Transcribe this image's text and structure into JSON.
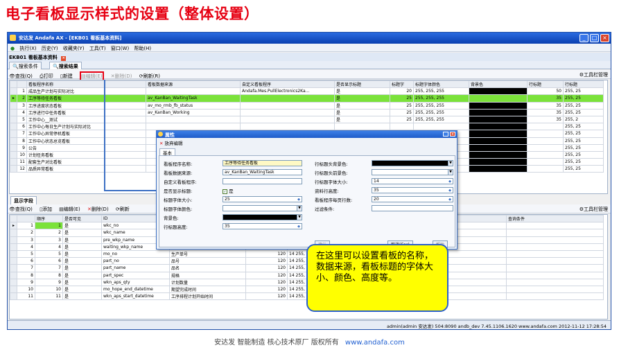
{
  "slide_title": "电子看板显示样式的设置（整体设置）",
  "window": {
    "title": "安达发 Andafa AX - [EKB01 看板基本资料]",
    "controls": [
      "_",
      "□",
      "×"
    ]
  },
  "menu": [
    "执行(X)",
    "历史(Y)",
    "收藏夹(Y)",
    "工具(T)",
    "窗口(W)",
    "帮助(H)"
  ],
  "doc_tab": "EKB01 看板基本资料",
  "tabs": [
    "搜索条件",
    "搜索结果"
  ],
  "toolbar1": {
    "find": "查找(Q)",
    "print": "打印",
    "new": "新建",
    "edit": "编辑(E)",
    "delete": "删除(D)",
    "refresh": "刷新(R)",
    "tool_manage": "工具栏管理"
  },
  "grid1": {
    "headers": [
      "看板程序名称",
      "看板数据来源",
      "自定义看板程序",
      "是否显示标题",
      "标题字",
      "标题字体颜色",
      "背景色",
      "行标题",
      "行标题"
    ],
    "rows": [
      {
        "no": "1",
        "name": "成品生产计划与实际对比",
        "source": "",
        "custom": "Andafa.Mes.PullElectronics2Ka...",
        "show": "是",
        "size": "20",
        "color": "255, 255, 255",
        "h": "50",
        "h2": "255, 25"
      },
      {
        "no": "2",
        "name": "工序等待任务看板",
        "source": "av_KanBan_WaitingTask",
        "custom": "",
        "show": "是",
        "size": "25",
        "color": "255, 255, 255",
        "h": "35",
        "h2": "255, 25"
      },
      {
        "no": "3",
        "name": "工序进度状态看板",
        "source": "av_mo_rmb_fb_status",
        "custom": "",
        "show": "是",
        "size": "25",
        "color": "255, 255, 255",
        "h": "35",
        "h2": "255, 25"
      },
      {
        "no": "4",
        "name": "工序进行中任务看板",
        "source": "av_KanBan_Working",
        "custom": "",
        "show": "是",
        "size": "25",
        "color": "255, 255, 255",
        "h": "35",
        "h2": "255, 25"
      },
      {
        "no": "5",
        "name": "工作中心__测试",
        "source": "",
        "custom": "",
        "show": "是",
        "size": "25",
        "color": "255, 255, 255",
        "h": "35",
        "h2": "255, 2"
      },
      {
        "no": "6",
        "name": "工作中心每日生产计划与实际对比",
        "source": "",
        "custom": "",
        "show": "",
        "size": "",
        "color": "",
        "h": "",
        "h2": "255, 25"
      },
      {
        "no": "7",
        "name": "工作中心异常停机看板",
        "source": "",
        "custom": "",
        "show": "",
        "size": "",
        "color": "",
        "h": "",
        "h2": "255, 25"
      },
      {
        "no": "8",
        "name": "工作中心状态总览看板",
        "source": "",
        "custom": "",
        "show": "",
        "size": "",
        "color": "",
        "h": "",
        "h2": "255, 25"
      },
      {
        "no": "9",
        "name": "公告",
        "source": "",
        "custom": "",
        "show": "",
        "size": "",
        "color": "",
        "h": "",
        "h2": "255, 25"
      },
      {
        "no": "10",
        "name": "计划任务看板",
        "source": "",
        "custom": "",
        "show": "",
        "size": "",
        "color": "",
        "h": "",
        "h2": "255, 25"
      },
      {
        "no": "11",
        "name": "配套生产对比看板",
        "source": "",
        "custom": "",
        "show": "",
        "size": "",
        "color": "",
        "h": "",
        "h2": "255, 25"
      },
      {
        "no": "12",
        "name": "品质异常看板",
        "source": "",
        "custom": "",
        "show": "",
        "size": "",
        "color": "",
        "h": "",
        "h2": "255, 25"
      }
    ]
  },
  "sub_tab": "显示字段",
  "toolbar2": {
    "find": "查找(Q)",
    "add": "添加",
    "edit": "编辑(E)",
    "delete": "删除(D)",
    "refresh": "刷新",
    "tool_manage": "工具栏管理"
  },
  "grid2": {
    "headers": [
      "顺序",
      "是否可见",
      "ID",
      "",
      "",
      "",
      "",
      "查询条件"
    ],
    "rows": [
      {
        "no": "1",
        "ord": "1",
        "vis": "是",
        "id": "wkc_no",
        "cap": "",
        "w": "",
        "x": ""
      },
      {
        "no": "2",
        "ord": "2",
        "vis": "是",
        "id": "wkc_name",
        "cap": "",
        "w": "",
        "x": ""
      },
      {
        "no": "3",
        "ord": "3",
        "vis": "是",
        "id": "pre_wkp_name",
        "cap": "",
        "w": "",
        "x": ""
      },
      {
        "no": "4",
        "ord": "4",
        "vis": "是",
        "id": "waiting_wkp_name",
        "cap": "待完成工艺名称",
        "w": "120",
        "x": "14 255,"
      },
      {
        "no": "5",
        "ord": "5",
        "vis": "是",
        "id": "mo_no",
        "cap": "生产单号",
        "w": "120",
        "x": "14 255,"
      },
      {
        "no": "6",
        "ord": "6",
        "vis": "是",
        "id": "part_no",
        "cap": "品号",
        "w": "120",
        "x": "14 255,"
      },
      {
        "no": "7",
        "ord": "7",
        "vis": "是",
        "id": "part_name",
        "cap": "品名",
        "w": "120",
        "x": "14 255,"
      },
      {
        "no": "8",
        "ord": "8",
        "vis": "是",
        "id": "part_spec",
        "cap": "规格",
        "w": "120",
        "x": "14 255,"
      },
      {
        "no": "9",
        "ord": "9",
        "vis": "是",
        "id": "wkn_aps_qty",
        "cap": "计划数量",
        "w": "120",
        "x": "14 255,"
      },
      {
        "no": "10",
        "ord": "10",
        "vis": "是",
        "id": "mo_hope_end_datetime",
        "cap": "期望完成时间",
        "w": "120",
        "x": "14 255,"
      },
      {
        "no": "11",
        "ord": "11",
        "vis": "是",
        "id": "wkn_aps_start_datetime",
        "cap": "工序排程计划开始时间",
        "w": "120",
        "x": "14 255, 255, 255"
      }
    ],
    "extra_cell": "CENTER 居中对齐"
  },
  "dialog": {
    "title": "属性",
    "cancel_edit": "放弃编辑",
    "tab": "基本",
    "fields": {
      "program_name_label": "看板程序名称:",
      "program_name": "工序等待任务看板",
      "data_source_label": "看板数据来源:",
      "data_source": "av_KanBan_WaitingTask",
      "custom_label": "自定义看板程序:",
      "custom": "",
      "show_title_label": "是否显示标题:",
      "show_title": "是",
      "title_font_size_label": "标题字体大小:",
      "title_font_size": "25",
      "title_font_color_label": "标题字体颜色:",
      "bg_color_label": "背景色:",
      "row_title_height_label": "行标题高度:",
      "row_title_height": "35",
      "row_header_bg_label": "行标题头背景色:",
      "row_header_fg_label": "行标题头前景色:",
      "row_header_font_size_label": "行标题字体大小:",
      "row_header_font_size": "14",
      "data_row_height_label": "资料行高度:",
      "data_row_height": "35",
      "rows_per_page_label": "看板程序每页行数:",
      "rows_per_page": "20",
      "filter_label": "过滤条件:",
      "filter": ""
    },
    "buttons": [
      "确认",
      "取消(Esc)",
      "帮助"
    ]
  },
  "callout": "在这里可以设置看板的名称，数据来源，看板标题的字体大小、颜色、高度等。",
  "status_bar": "admin(admin 安达发)  504:8090  andb_dev  7.45.1106.1620  www.andafa.com  2012-11-12 17:28:54",
  "footer": {
    "text": "安达发  智能制造 核心技术原厂  版权所有",
    "url": "www.andafa.com"
  },
  "colors": {
    "title_red": "#e60012",
    "selected_row": "#7be23a",
    "callout_bg": "#ffff00",
    "window_blue": "#1f4fa8"
  }
}
